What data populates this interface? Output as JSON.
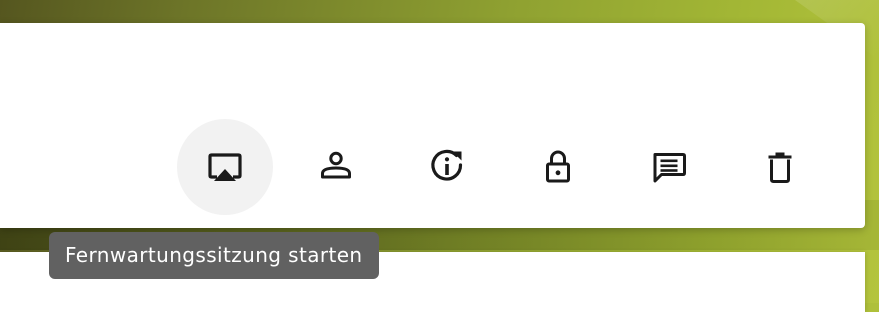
{
  "actions": [
    {
      "name": "remote-session",
      "icon": "airplay-icon",
      "label": "Fernwartungssitzung starten",
      "active": true
    },
    {
      "name": "user",
      "icon": "person-icon",
      "label": "",
      "active": false
    },
    {
      "name": "info-refresh",
      "icon": "info-refresh-icon",
      "label": "",
      "active": false
    },
    {
      "name": "lock",
      "icon": "lock-icon",
      "label": "",
      "active": false
    },
    {
      "name": "message",
      "icon": "message-icon",
      "label": "",
      "active": false
    },
    {
      "name": "delete",
      "icon": "trash-icon",
      "label": "",
      "active": false
    }
  ],
  "tooltip": {
    "text": "Fernwartungssitzung starten"
  },
  "colors": {
    "icon": "#1a1a1a",
    "tooltip_bg": "#616161",
    "tooltip_text": "#ffffff",
    "active_bg": "#f2f2f2",
    "card_bg": "#ffffff"
  }
}
